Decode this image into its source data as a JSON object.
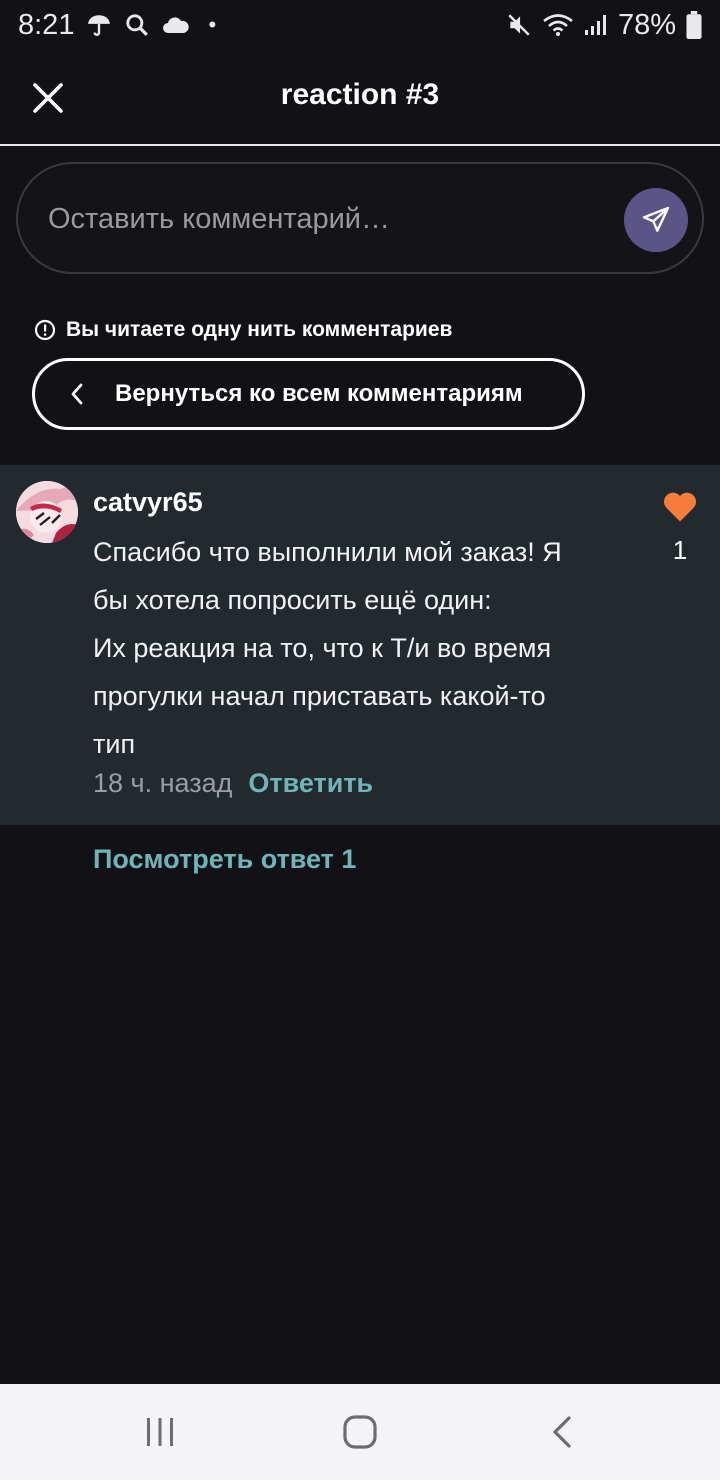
{
  "status_bar": {
    "time": "8:21",
    "left_icons": [
      "umbrella-icon",
      "search-icon",
      "cloud-icon"
    ],
    "right_icons": [
      "mute-icon",
      "wifi-icon",
      "signal-icon",
      "battery-icon"
    ],
    "battery": "78%"
  },
  "header": {
    "title": "reaction #3",
    "close_icon": "close-icon"
  },
  "comment_input": {
    "placeholder": "Оставить комментарий…",
    "send_icon": "send-icon",
    "send_color": "#5b5587"
  },
  "thread_notice": {
    "icon": "info-icon",
    "text": "Вы читаете одну нить комментариев"
  },
  "back_button": {
    "icon": "chevron-left-icon",
    "label": "Вернуться ко всем комментариям"
  },
  "comment": {
    "username": "catvyr65",
    "text_lines": [
      "Спасибо что выполнили мой заказ! Я",
      "бы хотела попросить ещё один:",
      "Их реакция на то, что к Т/и во время",
      "прогулки начал приставать какой-то",
      "тип"
    ],
    "timestamp": "18 ч. назад",
    "reply_label": "Ответить",
    "like_icon": "heart-icon",
    "like_color": "#f47c3c",
    "like_count": "1"
  },
  "view_replies": "Посмотреть ответ 1",
  "nav_bar": {
    "items": [
      "recent-apps-icon",
      "home-icon",
      "back-icon"
    ]
  },
  "colors": {
    "background": "#121115",
    "card": "#232a2f",
    "accent_link": "#6fb5b8"
  }
}
